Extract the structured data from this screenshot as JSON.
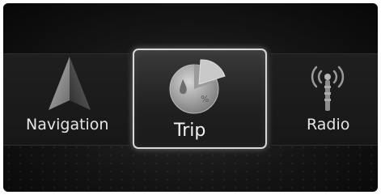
{
  "menu": {
    "items": [
      {
        "label": "Navigation",
        "icon": "navigation-arrow-icon"
      },
      {
        "label": "Trip",
        "icon": "trip-pie-chart-icon",
        "selected": true
      },
      {
        "label": "Radio",
        "icon": "radio-antenna-icon"
      }
    ]
  },
  "colors": {
    "background": "#141414",
    "highlight_border": "#d8d8d8",
    "label": "#e6e6e6"
  }
}
